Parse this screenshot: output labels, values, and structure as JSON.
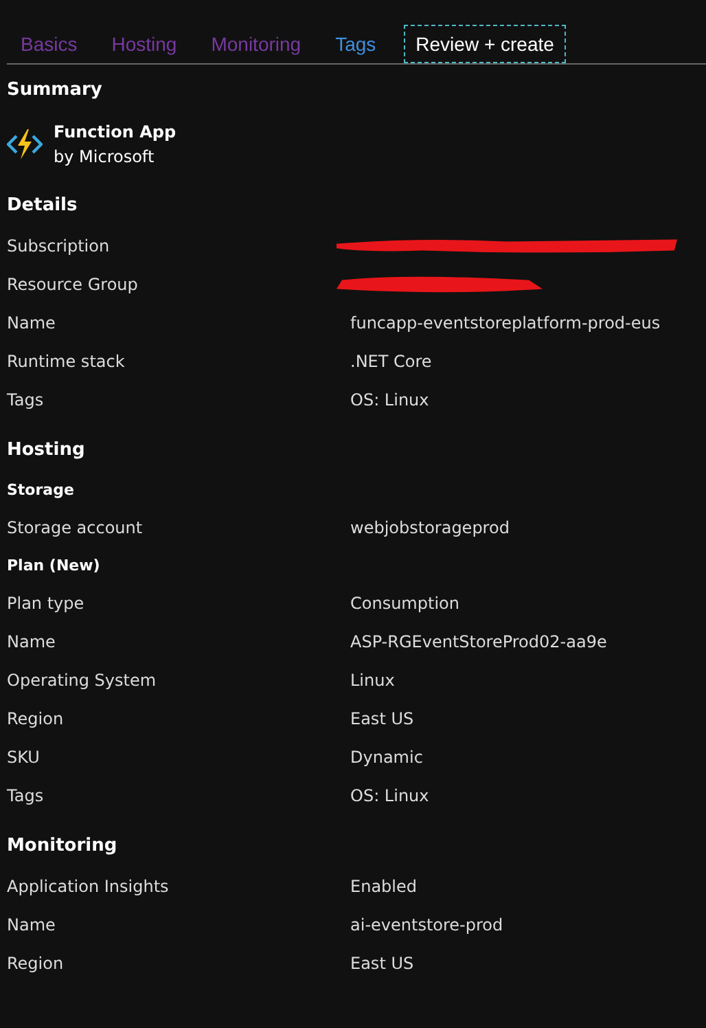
{
  "tabs": [
    {
      "label": "Basics",
      "kind": "visited",
      "selected": false
    },
    {
      "label": "Hosting",
      "kind": "visited",
      "selected": false
    },
    {
      "label": "Monitoring",
      "kind": "visited",
      "selected": false
    },
    {
      "label": "Tags",
      "kind": "link",
      "selected": false
    },
    {
      "label": "Review + create",
      "selected": true
    }
  ],
  "summary": {
    "title": "Summary",
    "app_name": "Function App",
    "publisher": "by Microsoft"
  },
  "sections": [
    {
      "title": "Details",
      "items": [
        {
          "kind": "row",
          "label": "Subscription",
          "redacted": true
        },
        {
          "kind": "row",
          "label": "Resource Group",
          "redacted": true
        },
        {
          "kind": "row",
          "label": "Name",
          "value": "funcapp-eventstoreplatform-prod-eus"
        },
        {
          "kind": "row",
          "label": "Runtime stack",
          "value": ".NET Core"
        },
        {
          "kind": "row",
          "label": "Tags",
          "value": "OS: Linux"
        }
      ]
    },
    {
      "title": "Hosting",
      "items": [
        {
          "kind": "subheading",
          "label": "Storage"
        },
        {
          "kind": "row",
          "label": "Storage account",
          "value": "webjobstorageprod"
        },
        {
          "kind": "subheading",
          "label": "Plan (New)"
        },
        {
          "kind": "row",
          "label": "Plan type",
          "value": "Consumption"
        },
        {
          "kind": "row",
          "label": "Name",
          "value": "ASP-RGEventStoreProd02-aa9e"
        },
        {
          "kind": "row",
          "label": "Operating System",
          "value": "Linux"
        },
        {
          "kind": "row",
          "label": "Region",
          "value": "East US"
        },
        {
          "kind": "row",
          "label": "SKU",
          "value": "Dynamic"
        },
        {
          "kind": "row",
          "label": "Tags",
          "value": "OS: Linux"
        }
      ]
    },
    {
      "title": "Monitoring",
      "items": [
        {
          "kind": "row",
          "label": "Application Insights",
          "value": "Enabled"
        },
        {
          "kind": "row",
          "label": "Name",
          "value": "ai-eventstore-prod"
        },
        {
          "kind": "row",
          "label": "Region",
          "value": "East US"
        }
      ]
    }
  ]
}
